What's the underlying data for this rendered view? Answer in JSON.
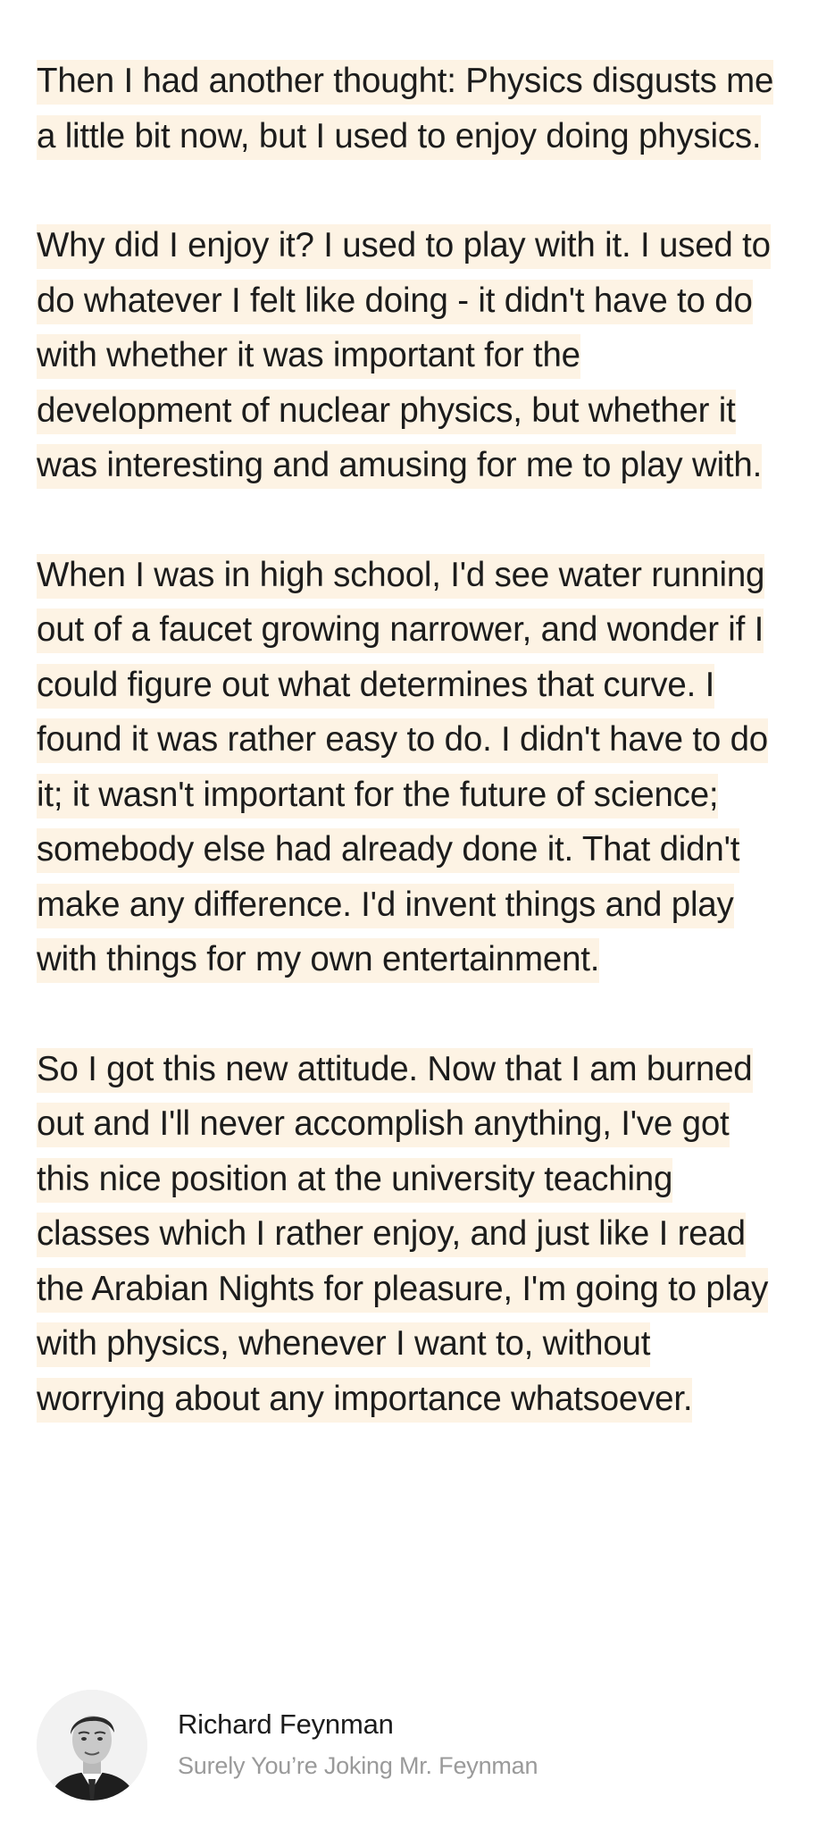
{
  "quote": {
    "paragraphs": [
      "Then I had another thought: Physics disgusts me a little bit now, but I used to enjoy doing physics.",
      "Why did I enjoy it? I used to play with it. I used to do whatever I felt like doing - it didn't have to do with whether it was important for the development of nuclear physics, but whether it was interesting and amusing for me to play with.",
      "When I was in high school, I'd see water running out of a faucet growing narrower, and wonder if I could figure out what determines that curve. I found it was rather easy to do. I didn't have to do it; it wasn't important for the future of science; somebody else had already done it. That didn't make any difference. I'd invent things and play with things for my own entertainment.",
      "So I got this new attitude. Now that I am burned out and I'll never accomplish anything, I've got this nice position at the university teaching classes which I rather enjoy, and just like I read the Arabian Nights for pleasure, I'm going to play with physics, whenever I want to, without worrying about any importance whatsoever."
    ],
    "highlight_color": "#fdf3e4"
  },
  "attribution": {
    "author": "Richard Feynman",
    "source": "Surely You’re Joking Mr. Feynman",
    "avatar_icon": "portrait-photo"
  }
}
